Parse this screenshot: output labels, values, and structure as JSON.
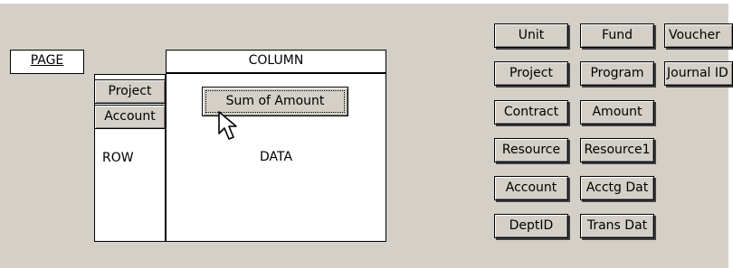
{
  "layout": {
    "page_label": "PAGE",
    "column_label": "COLUMN",
    "row_label": "ROW",
    "data_label": "DATA",
    "row_fields": [
      {
        "label": "Project"
      },
      {
        "label": "Account"
      }
    ],
    "data_fields": [
      {
        "label": "Sum of Amount"
      }
    ]
  },
  "field_list": [
    {
      "label": "Unit"
    },
    {
      "label": "Fund"
    },
    {
      "label": "Voucher"
    },
    {
      "label": "Project"
    },
    {
      "label": "Program"
    },
    {
      "label": "Journal ID"
    },
    {
      "label": "Contract"
    },
    {
      "label": "Amount"
    },
    {
      "label": "Resource"
    },
    {
      "label": "Resource1"
    },
    {
      "label": "Account"
    },
    {
      "label": "Acctg Dat"
    },
    {
      "label": "DeptID"
    },
    {
      "label": "Trans Dat"
    }
  ],
  "colors": {
    "dialog_face": "#d4d0c8",
    "zone_fill": "#ffffff",
    "border": "#000000"
  },
  "icons": {
    "cursor": "arrow-pointer-icon"
  }
}
